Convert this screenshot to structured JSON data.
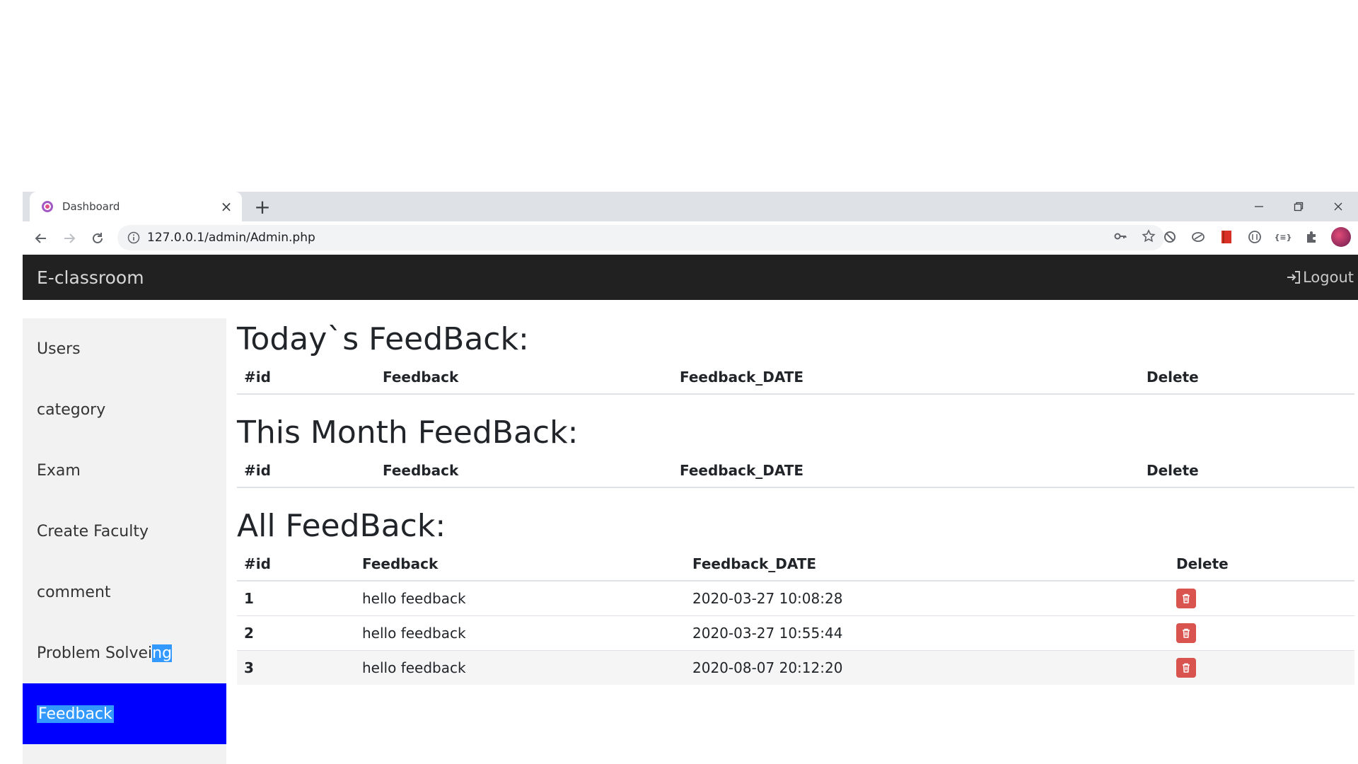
{
  "browser": {
    "tab_title": "Dashboard",
    "url": "127.0.0.1/admin/Admin.php",
    "new_tab_symbol": "+",
    "close_symbol": "×"
  },
  "navbar": {
    "brand": "E-classroom",
    "logout_label": "Logout"
  },
  "sidebar": {
    "items": [
      {
        "label": "Users"
      },
      {
        "label": "category"
      },
      {
        "label": "Exam"
      },
      {
        "label": "Create Faculty"
      },
      {
        "label": "comment"
      },
      {
        "label_main": "Problem Solvei",
        "label_highlight": "ng"
      },
      {
        "label": "Feedback",
        "active": true
      }
    ]
  },
  "sections": {
    "today": {
      "title": "Today`s FeedBack:",
      "headers": [
        "#id",
        "Feedback",
        "Feedback_DATE",
        "Delete"
      ]
    },
    "month": {
      "title": "This Month FeedBack:",
      "headers": [
        "#id",
        "Feedback",
        "Feedback_DATE",
        "Delete"
      ]
    },
    "all": {
      "title": "All FeedBack:",
      "headers": [
        "#id",
        "Feedback",
        "Feedback_DATE",
        "Delete"
      ],
      "rows": [
        {
          "id": "1",
          "feedback": "hello feedback",
          "date": "2020-03-27 10:08:28"
        },
        {
          "id": "2",
          "feedback": "hello feedback",
          "date": "2020-03-27 10:55:44"
        },
        {
          "id": "3",
          "feedback": "hello feedback",
          "date": "2020-08-07 20:12:20"
        }
      ]
    }
  },
  "colors": {
    "navbar_bg": "#212121",
    "sidebar_bg": "#f2f2f2",
    "active_bg": "#0000ff",
    "delete_btn": "#d9534f"
  }
}
